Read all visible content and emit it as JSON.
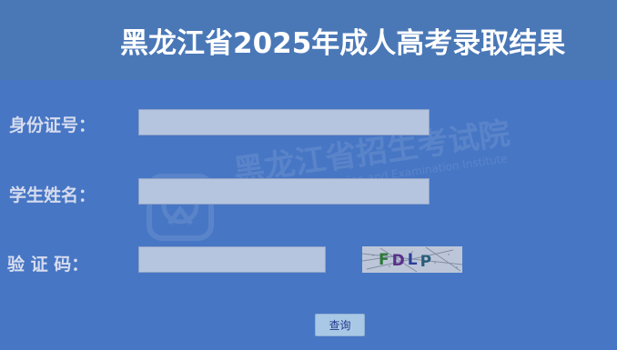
{
  "header": {
    "title": "黑龙江省2025年成人高考录取结果"
  },
  "watermark": {
    "org_name": "黑龙江省招生考试院",
    "org_name_en": "Heilongjiang Admission and Examination Institute"
  },
  "form": {
    "id_label": "身份证号：",
    "id_value": "",
    "name_label": "学生姓名：",
    "name_value": "",
    "code_label": "验 证 码：",
    "code_value": "",
    "captcha_text": "FDLP"
  },
  "actions": {
    "query_label": "查询"
  },
  "colors": {
    "background": "#4776c4",
    "header_bg": "#4a78b7",
    "field_bg": "#b6c5df",
    "button_bg": "#a9c8e6"
  }
}
